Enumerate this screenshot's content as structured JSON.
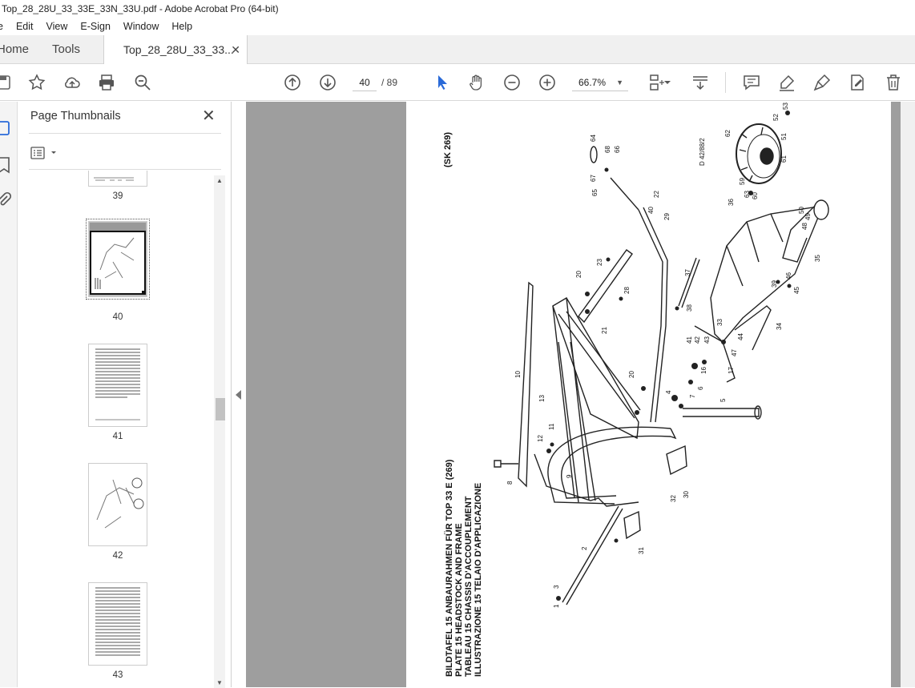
{
  "window": {
    "title": "Top_28_28U_33_33E_33N_33U.pdf - Adobe Acrobat Pro (64-bit)"
  },
  "menu": [
    "e",
    "Edit",
    "View",
    "E-Sign",
    "Window",
    "Help"
  ],
  "tabs": {
    "home": "Home",
    "tools": "Tools",
    "doc": "Top_28_28U_33_33...",
    "close": "✕"
  },
  "toolbar": {
    "page_current": "40",
    "page_total": "/ 89",
    "zoom": "66.7%"
  },
  "panel": {
    "title": "Page Thumbnails",
    "close": "✕",
    "thumbnails": [
      "39",
      "40",
      "41",
      "42",
      "43"
    ]
  },
  "page": {
    "code": "(SK 269)",
    "header_lines": [
      "BILDTAFEL     15     ANBAURAHMEN FÜR TOP 33 E (269)",
      "PLATE            15     HEADSTOCK  AND FRAME",
      "TABLEAU         15     CHASSIS D'ACCOUPLEMENT",
      "ILLUSTRAZIONE  15     TELAIO D'APPLICAZIONE"
    ],
    "drawing_ref": "D 42/88/2",
    "part_numbers": [
      "1",
      "2",
      "3",
      "4",
      "5",
      "6",
      "7",
      "8",
      "9",
      "10",
      "11",
      "12",
      "13",
      "16",
      "17",
      "20",
      "21",
      "22",
      "23",
      "28",
      "29",
      "30",
      "31",
      "32",
      "33",
      "34",
      "35",
      "36",
      "37",
      "38",
      "39",
      "40",
      "41",
      "42",
      "43",
      "44",
      "45",
      "46",
      "47",
      "48",
      "49",
      "50",
      "51",
      "52",
      "53",
      "59",
      "60",
      "61",
      "62",
      "63",
      "64",
      "65",
      "66",
      "67",
      "68"
    ]
  }
}
